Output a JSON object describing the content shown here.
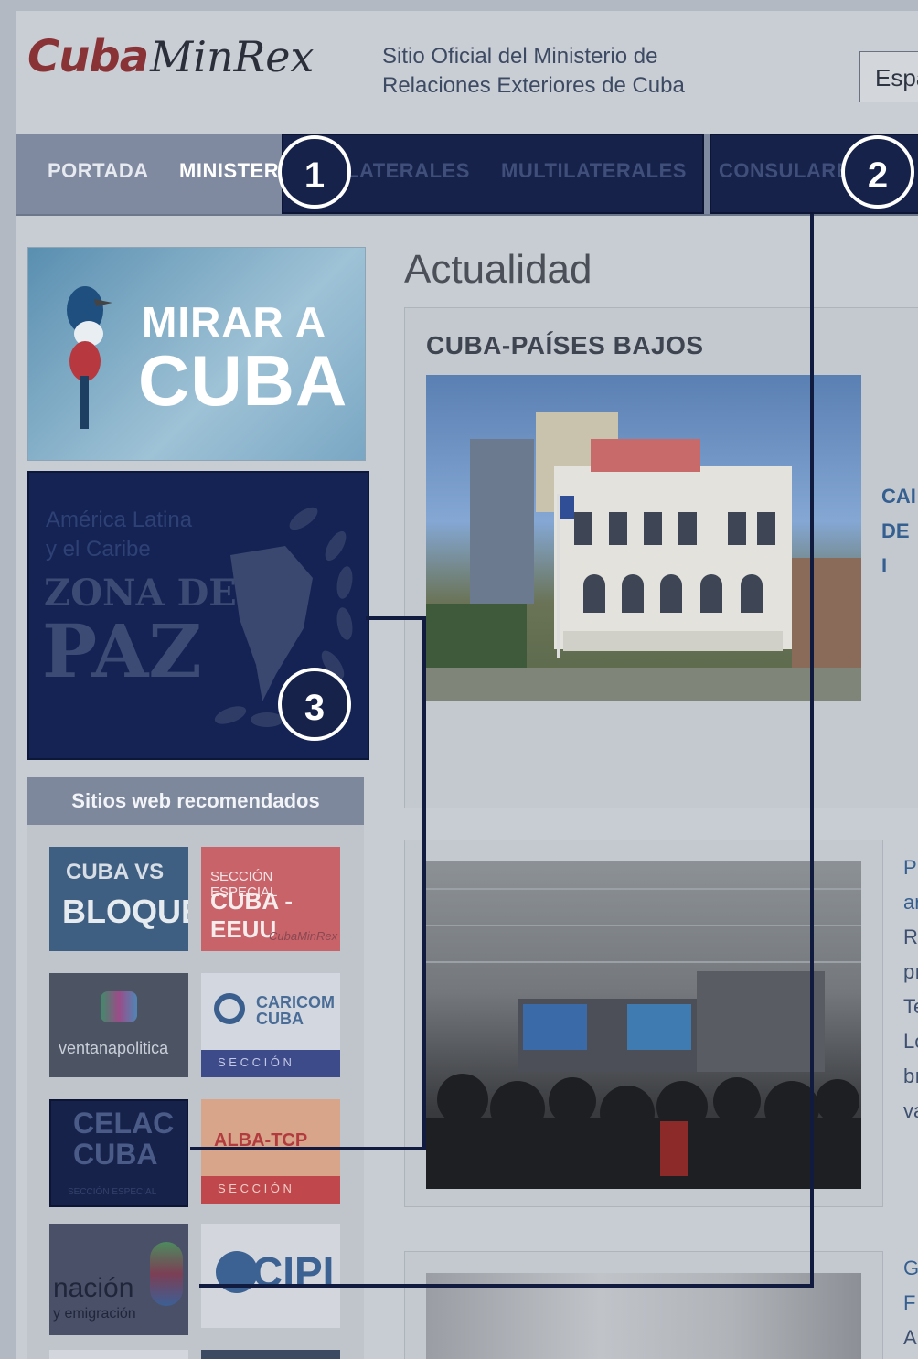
{
  "header": {
    "logo_cuba": "Cuba",
    "logo_minrex": "MinRex",
    "site_desc_line1": "Sitio Oficial del Ministerio de",
    "site_desc_line2": "Relaciones Exteriores de Cuba",
    "language": "Espa"
  },
  "nav": {
    "items": [
      "PORTADA",
      "MINISTERIO",
      "BILATERALES",
      "MULTILATERALES",
      "CONSULARES"
    ]
  },
  "callouts": [
    "1",
    "2",
    "3"
  ],
  "sidebar": {
    "banner1_line1": "MIRAR A",
    "banner1_line2": "CUBA",
    "banner2_line1": "América Latina",
    "banner2_line2": "y el Caribe",
    "banner2_zona": "ZONA DE",
    "banner2_paz": "PAZ",
    "recommended_title": "Sitios web recomendados",
    "tiles": {
      "bloqueo_1": "CUBA VS",
      "bloqueo_2": "BLOQUEO",
      "eeuu_1": "SECCIÓN ESPECIAL",
      "eeuu_2": "CUBA - EEUU",
      "eeuu_3": "CubaMinRex",
      "ventana": "ventanapolitica",
      "caricom_1": "CARICOM",
      "caricom_2": "CUBA",
      "caricom_3": "S E C C I Ó N",
      "celac_1": "CELAC",
      "celac_2": "CUBA",
      "celac_3": "SECCIÓN ESPECIAL",
      "alba_1": "ALBA-TCP",
      "alba_2": "S E C C I Ó N",
      "nacion_1": "nación",
      "nacion_2": "y emigración",
      "cipi": "CIPI"
    }
  },
  "main": {
    "section_title": "Actualidad",
    "card1_title": "CUBA-PAÍSES BAJOS",
    "card1_link_line1": "CAI",
    "card1_link_line2": "DE I",
    "card2_text": [
      "Pr",
      "ar",
      "R",
      "pı",
      "Te",
      "Lo",
      "bı",
      "va"
    ],
    "card3_text": [
      "G",
      "F",
      "A"
    ]
  },
  "colors": {
    "nav_highlight": "#16224a",
    "link": "#345f90",
    "logo_red": "#8a3337"
  }
}
